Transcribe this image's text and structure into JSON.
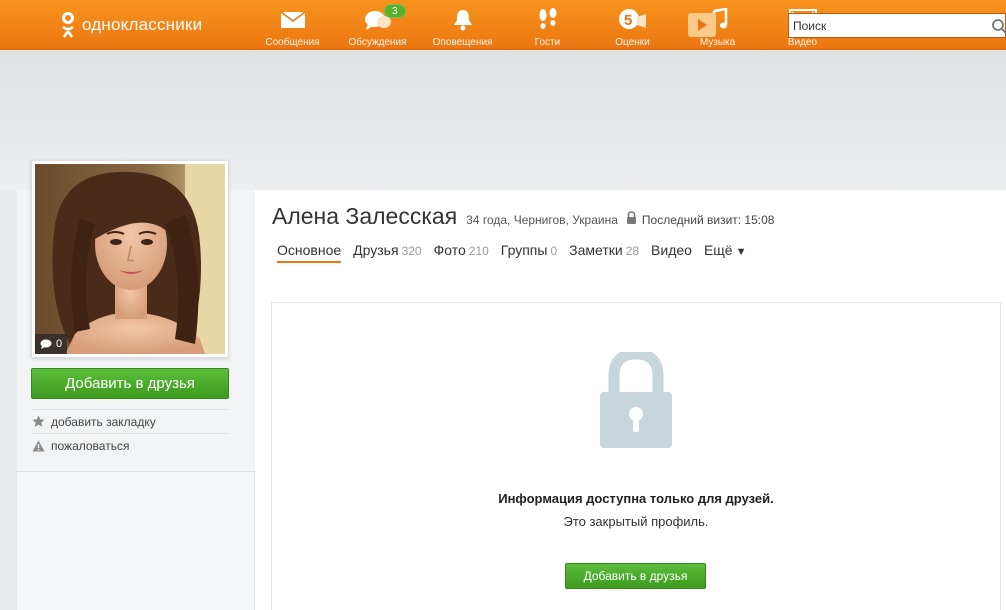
{
  "header": {
    "logo_text": "одноклассники",
    "nav": [
      {
        "label": "Сообщения",
        "icon": "envelope-icon"
      },
      {
        "label": "Обсуждения",
        "icon": "discussions-icon",
        "badge": "3"
      },
      {
        "label": "Оповещения",
        "icon": "bell-icon"
      },
      {
        "label": "Гости",
        "icon": "footprints-icon"
      },
      {
        "label": "Оценки",
        "icon": "ratings-icon"
      },
      {
        "label": "Музыка",
        "icon": "music-note-icon"
      },
      {
        "label": "Видео",
        "icon": "video-icon"
      }
    ],
    "search": {
      "placeholder": "Поиск",
      "value": ""
    }
  },
  "sidebar": {
    "comment_count": "0",
    "add_friend_label": "Добавить в друзья",
    "bookmark_label": "добавить закладку",
    "report_label": "пожаловаться"
  },
  "profile": {
    "name": "Алена Залесская",
    "meta": "34 года, Чернигов, Украина",
    "last_visit": "Последний визит: 15:08",
    "tabs": [
      {
        "label": "Основное",
        "count": ""
      },
      {
        "label": "Друзья",
        "count": "320"
      },
      {
        "label": "Фото",
        "count": "210"
      },
      {
        "label": "Группы",
        "count": "0"
      },
      {
        "label": "Заметки",
        "count": "28"
      },
      {
        "label": "Видео",
        "count": ""
      },
      {
        "label": "Ещё",
        "count": ""
      }
    ]
  },
  "private": {
    "title": "Информация доступна только для друзей.",
    "subtitle": "Это закрытый профиль.",
    "add_friend_label": "Добавить в друзья"
  },
  "colors": {
    "brand_orange": "#ec7612",
    "green_button": "#4aa82a",
    "lock_gray": "#c7d6db"
  }
}
